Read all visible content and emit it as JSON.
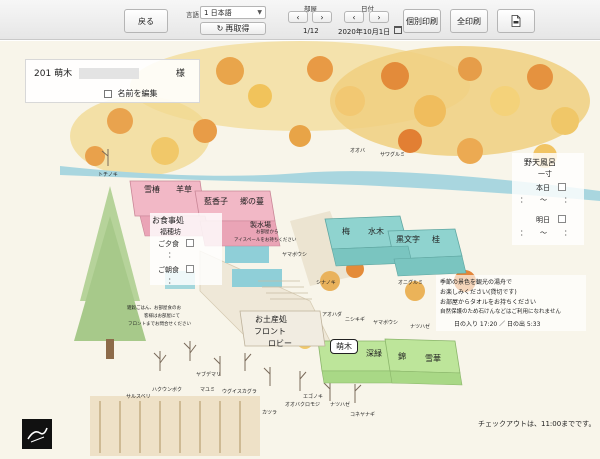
{
  "toolbar": {
    "back_label": "戻る",
    "language_label": "言語",
    "language_value": "1 日本語",
    "reload_label": "再取得",
    "room_label": "部屋",
    "room_page": "1/12",
    "date_label": "日付",
    "date_value": "2020年10月1日",
    "print_single_label": "個別印刷",
    "print_all_label": "全印刷"
  },
  "guest": {
    "room_number": "201",
    "room_name": "萌木",
    "honorific": "様",
    "edit_name_label": "名前を編集"
  },
  "open_bath": {
    "title": "野天風呂",
    "bath_name": "一寸",
    "today_label": "本日",
    "tomorrow_label": "明日",
    "time_separator": "：",
    "range_mark": "〜"
  },
  "meal": {
    "title": "お食事処",
    "venue": "福穂坊",
    "dinner_label": "ご夕食",
    "breakfast_label": "ご朝食",
    "time_separator": "：",
    "note_lines": [
      "雑穀ごはん、お部屋食のお",
      "客様はお部屋にて",
      "フロントまでお問合せください"
    ]
  },
  "seikei": {
    "title": "製水場",
    "note_lines": [
      "お部屋から",
      "アイスペールをお持ちください"
    ]
  },
  "notice": {
    "lines": [
      "季節の景色を観光の湯舟で",
      "お楽しみください(貸切です)",
      "お部屋からタオルをお持ちください",
      "自然保護のため石けんなどはご利用になれません"
    ],
    "sunrise_sunset": "日の入り 17:20 ／ 日の出 5:33"
  },
  "checkout": "チェックアウトは、11:00までです。",
  "buildings": [
    {
      "name": "雪椿",
      "color": "#f2b8c6"
    },
    {
      "name": "羊草",
      "color": "#f2b8c6"
    },
    {
      "name": "藍香子",
      "color": "#f2b8c6"
    },
    {
      "name": "郷の蔓",
      "color": "#f2b8c6"
    },
    {
      "name": "梅",
      "color": "#8fd3cf"
    },
    {
      "name": "水木",
      "color": "#8fd3cf"
    },
    {
      "name": "黒文字",
      "color": "#8fd3cf"
    },
    {
      "name": "桂",
      "color": "#8fd3cf"
    },
    {
      "name": "萌木",
      "color": "#bde59a"
    },
    {
      "name": "深緑",
      "color": "#bde59a"
    },
    {
      "name": "錦",
      "color": "#bde59a"
    },
    {
      "name": "雪華",
      "color": "#bde59a"
    }
  ],
  "facilities": [
    "お土産処",
    "フロント",
    "ロビー"
  ],
  "tree_labels": [
    "トチノキ",
    "サワグルミ",
    "オオバ",
    "ヤマボウシ",
    "シナノキ",
    "オニグルミ",
    "アオハダ",
    "ニシキギ",
    "ヤマボウシ",
    "ナツハゼ",
    "カツラ",
    "エゴノキ",
    "オオバクロモジ",
    "ナツハゼ",
    "コネヤナギ",
    "ヤブデマリ",
    "ハクウンボク",
    "マユミ",
    "ウグイスカグラ",
    "サルスベリ"
  ],
  "colors": {
    "toolbar_bg": "#eeeeee",
    "pink_building": "#f2b8c6",
    "teal_building": "#8fd3cf",
    "green_building": "#bde59a",
    "autumn_orange": "#e8a040",
    "autumn_yellow": "#f1d488",
    "river": "#a9d6df"
  },
  "icons": [
    "chevron-left-icon",
    "chevron-right-icon",
    "reload-icon",
    "calendar-icon",
    "pdf-icon",
    "logo-icon"
  ]
}
